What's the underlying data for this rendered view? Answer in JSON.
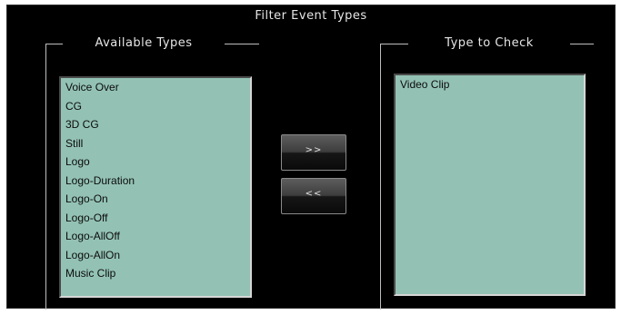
{
  "dialog": {
    "title": "Filter Event Types"
  },
  "available": {
    "label": "Available Types",
    "items": [
      "Voice Over",
      "CG",
      "3D CG",
      "Still",
      "Logo",
      "Logo-Duration",
      "Logo-On",
      "Logo-Off",
      "Logo-AllOff",
      "Logo-AllOn",
      "Music Clip"
    ]
  },
  "checked": {
    "label": "Type to Check",
    "items": [
      "Video Clip"
    ]
  },
  "buttons": {
    "add_label": ">>",
    "remove_label": "<<"
  },
  "colors": {
    "background": "#000000",
    "list_background": "#93c2b4",
    "text": "#e6e6e6"
  }
}
